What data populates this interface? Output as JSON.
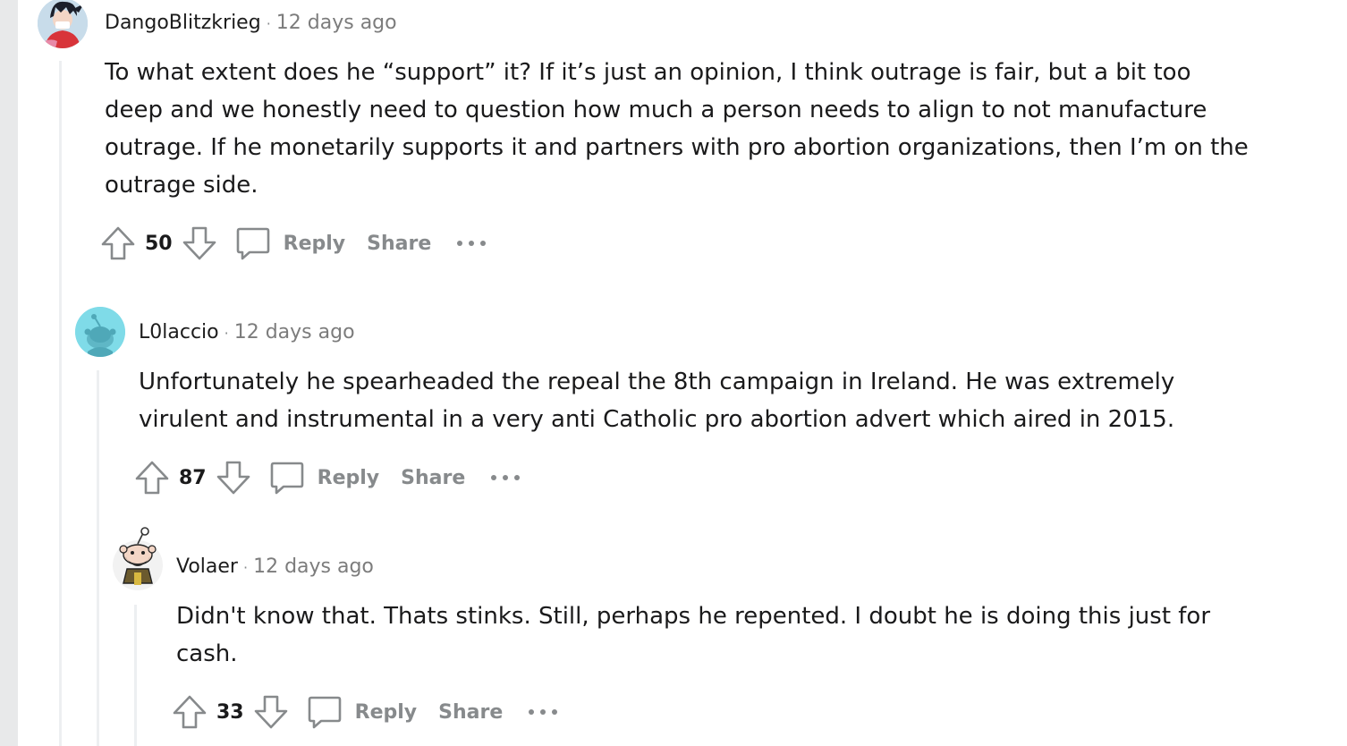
{
  "colors": {
    "background": "#e8e9ea",
    "panel": "#ffffff",
    "muted": "#878a8c",
    "text": "#1a1a1b",
    "thread_line": "#edeff1"
  },
  "comments": [
    {
      "username": "DangoBlitzkrieg",
      "time": "12 days ago",
      "body": "To what extent does he “support” it? If it’s just an opinion, I think outrage is fair, but a bit too deep and we honestly need to question how much a person needs to align to not manufacture outrage. If he monetarily supports it and partners with pro abortion organizations, then I’m on the outrage side.",
      "score": "50",
      "reply_label": "Reply",
      "share_label": "Share",
      "avatar_icon": "avatar-anime-character"
    },
    {
      "username": "L0laccio",
      "time": "12 days ago",
      "body": "Unfortunately he spearheaded the repeal the 8th campaign in Ireland. He was extremely virulent and instrumental in a very anti Catholic pro abortion advert which aired in 2015.",
      "score": "87",
      "reply_label": "Reply",
      "share_label": "Share",
      "avatar_icon": "default-snoo-avatar"
    },
    {
      "username": "Volaer",
      "time": "12 days ago",
      "body": "Didn't know that. Thats stinks. Still, perhaps he repented. I doubt he is doing this just for cash.",
      "score": "33",
      "reply_label": "Reply",
      "share_label": "Share",
      "avatar_icon": "bearded-snoo-avatar"
    }
  ]
}
